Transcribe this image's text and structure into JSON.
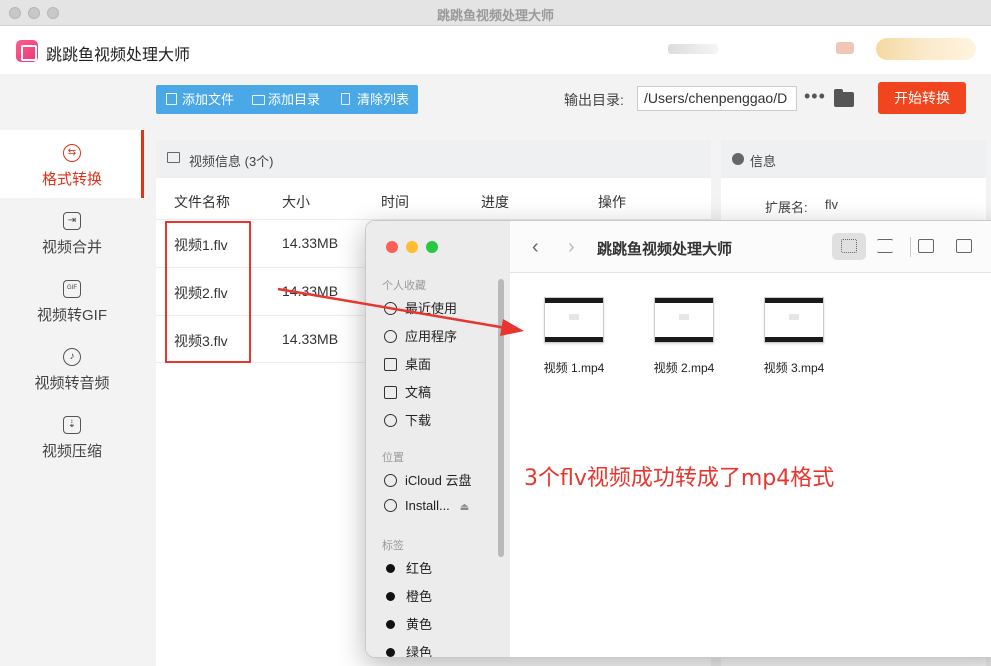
{
  "window": {
    "title": "跳跳鱼视频处理大师"
  },
  "app": {
    "name": "跳跳鱼视频处理大师"
  },
  "sidebar": {
    "items": [
      {
        "label": "格式转换",
        "icon": "exchange-icon",
        "active": true
      },
      {
        "label": "视频合并",
        "icon": "merge-icon",
        "active": false
      },
      {
        "label": "视频转GIF",
        "icon": "gif-icon",
        "active": false
      },
      {
        "label": "视频转音频",
        "icon": "audio-icon",
        "active": false
      },
      {
        "label": "视频压缩",
        "icon": "compress-icon",
        "active": false
      }
    ]
  },
  "toolbar": {
    "add_file": "添加文件",
    "add_folder": "添加目录",
    "clear_list": "清除列表",
    "output_label": "输出目录:",
    "output_path": "/Users/chenpenggao/D",
    "more": "•••",
    "start": "开始转换"
  },
  "video_panel": {
    "title": "视频信息 (3个)",
    "columns": [
      "文件名称",
      "大小",
      "时间",
      "进度",
      "操作"
    ],
    "rows": [
      {
        "name": "视频1.flv",
        "size": "14.33MB"
      },
      {
        "name": "视频2.flv",
        "size": "14.33MB"
      },
      {
        "name": "视频3.flv",
        "size": "14.33MB"
      }
    ]
  },
  "info_panel": {
    "title": "信息",
    "ext_label": "扩展名:",
    "ext_value": "flv"
  },
  "finder": {
    "title": "跳跳鱼视频处理大师",
    "sections": {
      "favorites": "个人收藏",
      "locations": "位置",
      "tags": "标签"
    },
    "favorites": [
      "最近使用",
      "应用程序",
      "桌面",
      "文稿",
      "下载"
    ],
    "locations": [
      "iCloud 云盘",
      "Install..."
    ],
    "tags": [
      "红色",
      "橙色",
      "黄色",
      "绿色"
    ],
    "files": [
      "视频 1.mp4",
      "视频 2.mp4",
      "视频 3.mp4"
    ]
  },
  "annotation": "3个flv视频成功转成了mp4格式",
  "colors": {
    "accent": "#e0321a",
    "toolbar": "#4aa8e6",
    "start": "#f0451f",
    "annotation": "#e8352d"
  }
}
